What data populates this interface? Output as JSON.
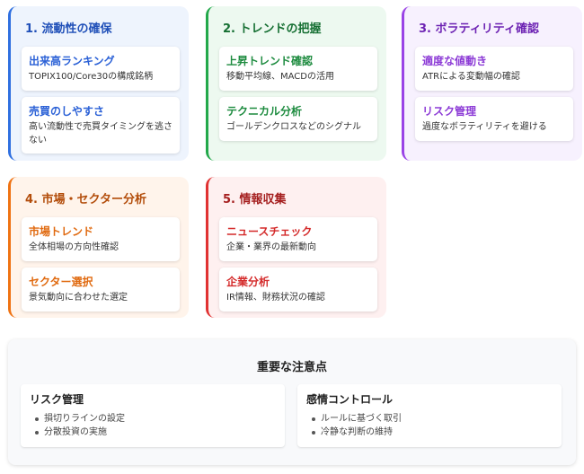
{
  "cards": [
    {
      "title": "1. 流動性の確保",
      "items": [
        {
          "title": "出来高ランキング",
          "desc": "TOPIX100/Core30の構成銘柄"
        },
        {
          "title": "売買のしやすさ",
          "desc": "高い流動性で売買タイミングを逃さない"
        }
      ]
    },
    {
      "title": "2. トレンドの把握",
      "items": [
        {
          "title": "上昇トレンド確認",
          "desc": "移動平均線、MACDの活用"
        },
        {
          "title": "テクニカル分析",
          "desc": "ゴールデンクロスなどのシグナル"
        }
      ]
    },
    {
      "title": "3. ボラティリティ確認",
      "items": [
        {
          "title": "適度な値動き",
          "desc": "ATRによる変動幅の確認"
        },
        {
          "title": "リスク管理",
          "desc": "過度なボラティリティを避ける"
        }
      ]
    },
    {
      "title": "4. 市場・セクター分析",
      "items": [
        {
          "title": "市場トレンド",
          "desc": "全体相場の方向性確認"
        },
        {
          "title": "セクター選択",
          "desc": "景気動向に合わせた選定"
        }
      ]
    },
    {
      "title": "5. 情報収集",
      "items": [
        {
          "title": "ニュースチェック",
          "desc": "企業・業界の最新動向"
        },
        {
          "title": "企業分析",
          "desc": "IR情報、財務状況の確認"
        }
      ]
    }
  ],
  "notes": {
    "title": "重要な注意点",
    "boxes": [
      {
        "title": "リスク管理",
        "bullets": [
          "損切りラインの設定",
          "分散投資の実施"
        ]
      },
      {
        "title": "感情コントロール",
        "bullets": [
          "ルールに基づく取引",
          "冷静な判断の維持"
        ]
      }
    ]
  }
}
